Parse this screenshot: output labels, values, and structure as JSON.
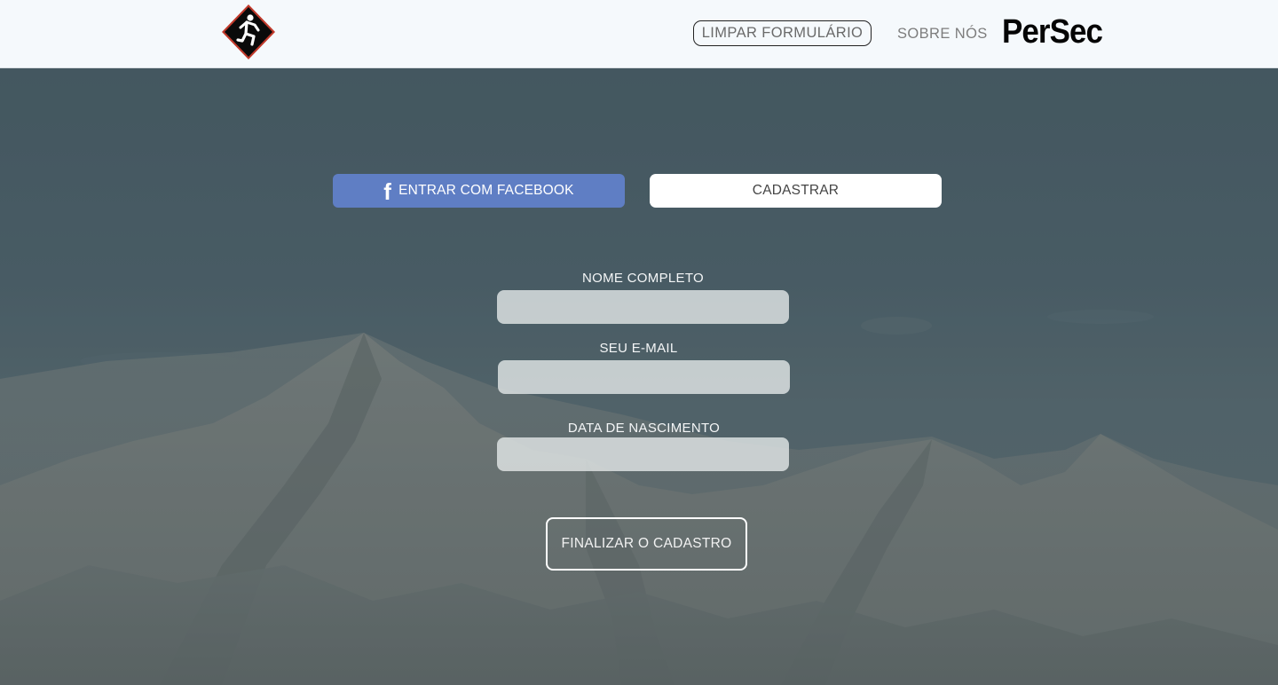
{
  "header": {
    "logo_icon": "running-man-diamond-icon",
    "clear_form_label": "LIMPAR FORMULÁRIO",
    "about_label": "SOBRE NÓS",
    "brand": "PerSec"
  },
  "actions": {
    "facebook_icon": "facebook-icon",
    "facebook_label": "ENTRAR COM FACEBOOK",
    "register_label": "CADASTRAR"
  },
  "form": {
    "full_name": {
      "label": "NOME COMPLETO",
      "value": "",
      "placeholder": ""
    },
    "email": {
      "label": "SEU E-MAIL",
      "value": "",
      "placeholder": ""
    },
    "birth_date": {
      "label": "DATA DE NASCIMENTO",
      "value": "",
      "placeholder": ""
    },
    "submit_label": "FINALIZAR O CADASTRO"
  },
  "colors": {
    "header_bg": "#f5f9fc",
    "facebook_blue": "#5f7ec4",
    "overlay": "#46565f"
  }
}
